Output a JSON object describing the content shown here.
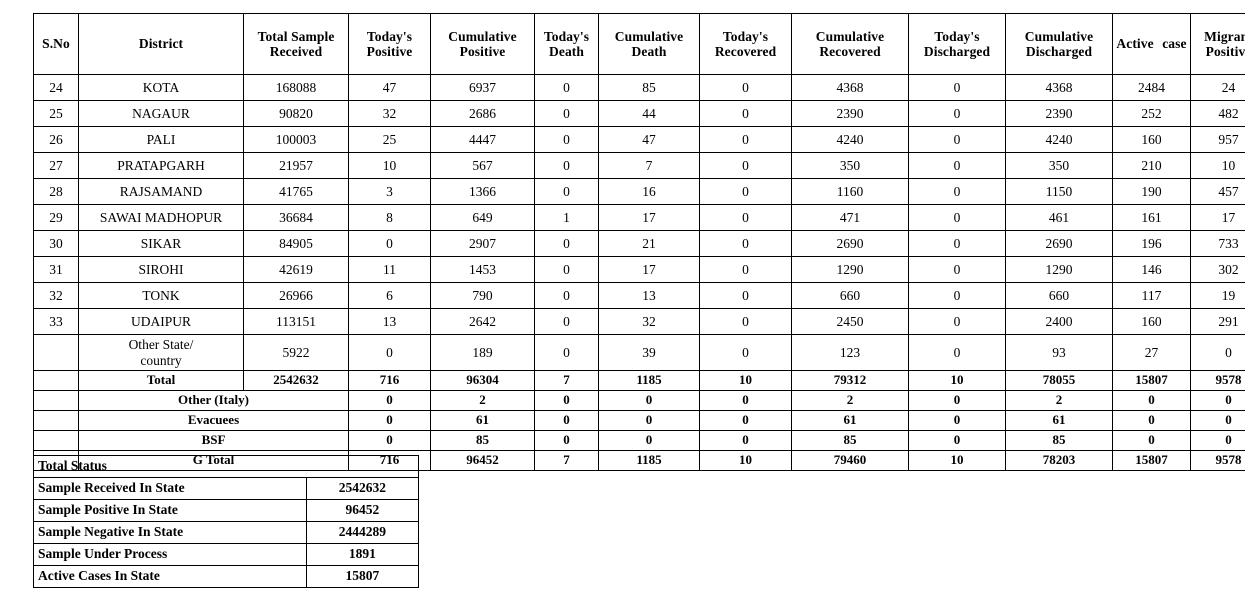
{
  "district_table": {
    "columns": [
      "S.No",
      "District",
      "Total Sample Received",
      "Today's Positive",
      "Cumulative Positive",
      "Today's Death",
      "Cumulative Death",
      "Today's Recovered",
      "Cumulative Recovered",
      "Today's Discharged",
      "Cumulative Discharged",
      "Active case",
      "Migrant Positive"
    ],
    "columns_split": [
      {
        "l1": "S.No",
        "l2": ""
      },
      {
        "l1": "District",
        "l2": ""
      },
      {
        "l1": "Total Sample",
        "l2": "Received"
      },
      {
        "l1": "Today's",
        "l2": "Positive"
      },
      {
        "l1": "Cumulative",
        "l2": "Positive"
      },
      {
        "l1": "Today's",
        "l2": "Death"
      },
      {
        "l1": "Cumulative",
        "l2": "Death"
      },
      {
        "l1": "Today's",
        "l2": "Recovered"
      },
      {
        "l1": "Cumulative",
        "l2": "Recovered"
      },
      {
        "l1": "Today's",
        "l2": "Discharged"
      },
      {
        "l1": "Cumulative",
        "l2": "Discharged"
      },
      {
        "l1": "Active case",
        "l2": ""
      },
      {
        "l1": "Migrant",
        "l2": "Positive"
      }
    ],
    "rows": [
      {
        "sno": "24",
        "district": "KOTA",
        "sample": "168088",
        "today_positive": "47",
        "cum_positive": "6937",
        "today_death": "0",
        "cum_death": "85",
        "today_recovered": "0",
        "cum_recovered": "4368",
        "today_discharged": "0",
        "cum_discharged": "4368",
        "active": "2484",
        "migrant": "24"
      },
      {
        "sno": "25",
        "district": "NAGAUR",
        "sample": "90820",
        "today_positive": "32",
        "cum_positive": "2686",
        "today_death": "0",
        "cum_death": "44",
        "today_recovered": "0",
        "cum_recovered": "2390",
        "today_discharged": "0",
        "cum_discharged": "2390",
        "active": "252",
        "migrant": "482"
      },
      {
        "sno": "26",
        "district": "PALI",
        "sample": "100003",
        "today_positive": "25",
        "cum_positive": "4447",
        "today_death": "0",
        "cum_death": "47",
        "today_recovered": "0",
        "cum_recovered": "4240",
        "today_discharged": "0",
        "cum_discharged": "4240",
        "active": "160",
        "migrant": "957"
      },
      {
        "sno": "27",
        "district": "PRATAPGARH",
        "sample": "21957",
        "today_positive": "10",
        "cum_positive": "567",
        "today_death": "0",
        "cum_death": "7",
        "today_recovered": "0",
        "cum_recovered": "350",
        "today_discharged": "0",
        "cum_discharged": "350",
        "active": "210",
        "migrant": "10"
      },
      {
        "sno": "28",
        "district": "RAJSAMAND",
        "sample": "41765",
        "today_positive": "3",
        "cum_positive": "1366",
        "today_death": "0",
        "cum_death": "16",
        "today_recovered": "0",
        "cum_recovered": "1160",
        "today_discharged": "0",
        "cum_discharged": "1150",
        "active": "190",
        "migrant": "457"
      },
      {
        "sno": "29",
        "district": "SAWAI MADHOPUR",
        "sample": "36684",
        "today_positive": "8",
        "cum_positive": "649",
        "today_death": "1",
        "cum_death": "17",
        "today_recovered": "0",
        "cum_recovered": "471",
        "today_discharged": "0",
        "cum_discharged": "461",
        "active": "161",
        "migrant": "17"
      },
      {
        "sno": "30",
        "district": "SIKAR",
        "sample": "84905",
        "today_positive": "0",
        "cum_positive": "2907",
        "today_death": "0",
        "cum_death": "21",
        "today_recovered": "0",
        "cum_recovered": "2690",
        "today_discharged": "0",
        "cum_discharged": "2690",
        "active": "196",
        "migrant": "733"
      },
      {
        "sno": "31",
        "district": "SIROHI",
        "sample": "42619",
        "today_positive": "11",
        "cum_positive": "1453",
        "today_death": "0",
        "cum_death": "17",
        "today_recovered": "0",
        "cum_recovered": "1290",
        "today_discharged": "0",
        "cum_discharged": "1290",
        "active": "146",
        "migrant": "302"
      },
      {
        "sno": "32",
        "district": "TONK",
        "sample": "26966",
        "today_positive": "6",
        "cum_positive": "790",
        "today_death": "0",
        "cum_death": "13",
        "today_recovered": "0",
        "cum_recovered": "660",
        "today_discharged": "0",
        "cum_discharged": "660",
        "active": "117",
        "migrant": "19"
      },
      {
        "sno": "33",
        "district": "UDAIPUR",
        "sample": "113151",
        "today_positive": "13",
        "cum_positive": "2642",
        "today_death": "0",
        "cum_death": "32",
        "today_recovered": "0",
        "cum_recovered": "2450",
        "today_discharged": "0",
        "cum_discharged": "2400",
        "active": "160",
        "migrant": "291"
      }
    ],
    "other_state_row": {
      "sno": "",
      "district_line1": "Other State/",
      "district_line2": "country",
      "sample": "5922",
      "today_positive": "0",
      "cum_positive": "189",
      "today_death": "0",
      "cum_death": "39",
      "today_recovered": "0",
      "cum_recovered": "123",
      "today_discharged": "0",
      "cum_discharged": "93",
      "active": "27",
      "migrant": "0"
    },
    "total_row": {
      "label": "Total",
      "sample": "2542632",
      "today_positive": "716",
      "cum_positive": "96304",
      "today_death": "7",
      "cum_death": "1185",
      "today_recovered": "10",
      "cum_recovered": "79312",
      "today_discharged": "10",
      "cum_discharged": "78055",
      "active": "15807",
      "migrant": "9578"
    },
    "extra_rows": [
      {
        "label": "Other (Italy)",
        "today_positive": "0",
        "cum_positive": "2",
        "today_death": "0",
        "cum_death": "0",
        "today_recovered": "0",
        "cum_recovered": "2",
        "today_discharged": "0",
        "cum_discharged": "2",
        "active": "0",
        "migrant": "0"
      },
      {
        "label": "Evacuees",
        "today_positive": "0",
        "cum_positive": "61",
        "today_death": "0",
        "cum_death": "0",
        "today_recovered": "0",
        "cum_recovered": "61",
        "today_discharged": "0",
        "cum_discharged": "61",
        "active": "0",
        "migrant": "0"
      },
      {
        "label": "BSF",
        "today_positive": "0",
        "cum_positive": "85",
        "today_death": "0",
        "cum_death": "0",
        "today_recovered": "0",
        "cum_recovered": "85",
        "today_discharged": "0",
        "cum_discharged": "85",
        "active": "0",
        "migrant": "0"
      },
      {
        "label": "G Total",
        "today_positive": "716",
        "cum_positive": "96452",
        "today_death": "7",
        "cum_death": "1185",
        "today_recovered": "10",
        "cum_recovered": "79460",
        "today_discharged": "10",
        "cum_discharged": "78203",
        "active": "15807",
        "migrant": "9578"
      }
    ]
  },
  "status_table": {
    "title": "Total Status",
    "rows": [
      {
        "label": "Sample Received In State",
        "value": "2542632"
      },
      {
        "label": "Sample Positive In State",
        "value": "96452"
      },
      {
        "label": "Sample Negative In State",
        "value": "2444289"
      },
      {
        "label": "Sample Under Process",
        "value": "1891"
      },
      {
        "label": "Active Cases In State",
        "value": "15807"
      }
    ]
  }
}
